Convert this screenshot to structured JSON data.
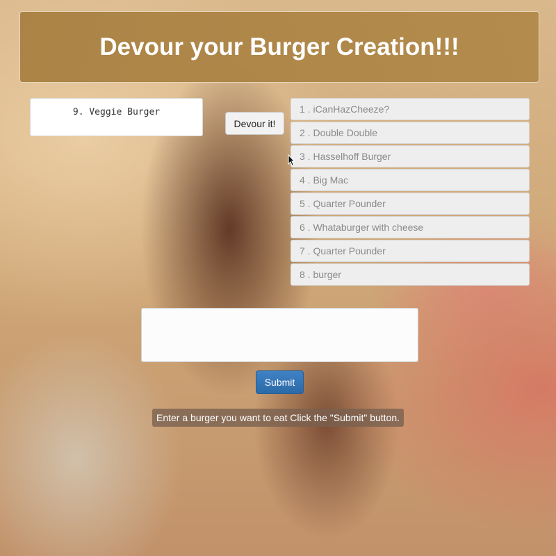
{
  "header": {
    "title": "Devour your Burger Creation!!!"
  },
  "selected": {
    "text": "9. Veggie Burger"
  },
  "devour_button": {
    "label": "Devour it!"
  },
  "burgers": [
    {
      "label": "1 . iCanHazCheeze?"
    },
    {
      "label": "2 . Double Double"
    },
    {
      "label": "3 . Hasselhoff Burger"
    },
    {
      "label": "4 . Big Mac"
    },
    {
      "label": "5 . Quarter Pounder"
    },
    {
      "label": "6 . Whataburger with cheese"
    },
    {
      "label": "7 . Quarter Pounder"
    },
    {
      "label": "8 . burger"
    }
  ],
  "burger_input": {
    "value": "",
    "placeholder": ""
  },
  "submit_button": {
    "label": "Submit"
  },
  "hint": {
    "text": "Enter a burger you want to eat Click the \"Submit\" button."
  },
  "colors": {
    "banner": "#a8803f",
    "submit": "#337ab7",
    "list_item_bg": "#eeeeee",
    "list_item_text": "#8a8a8a"
  },
  "icons": {
    "cursor": "mouse-pointer-icon"
  }
}
